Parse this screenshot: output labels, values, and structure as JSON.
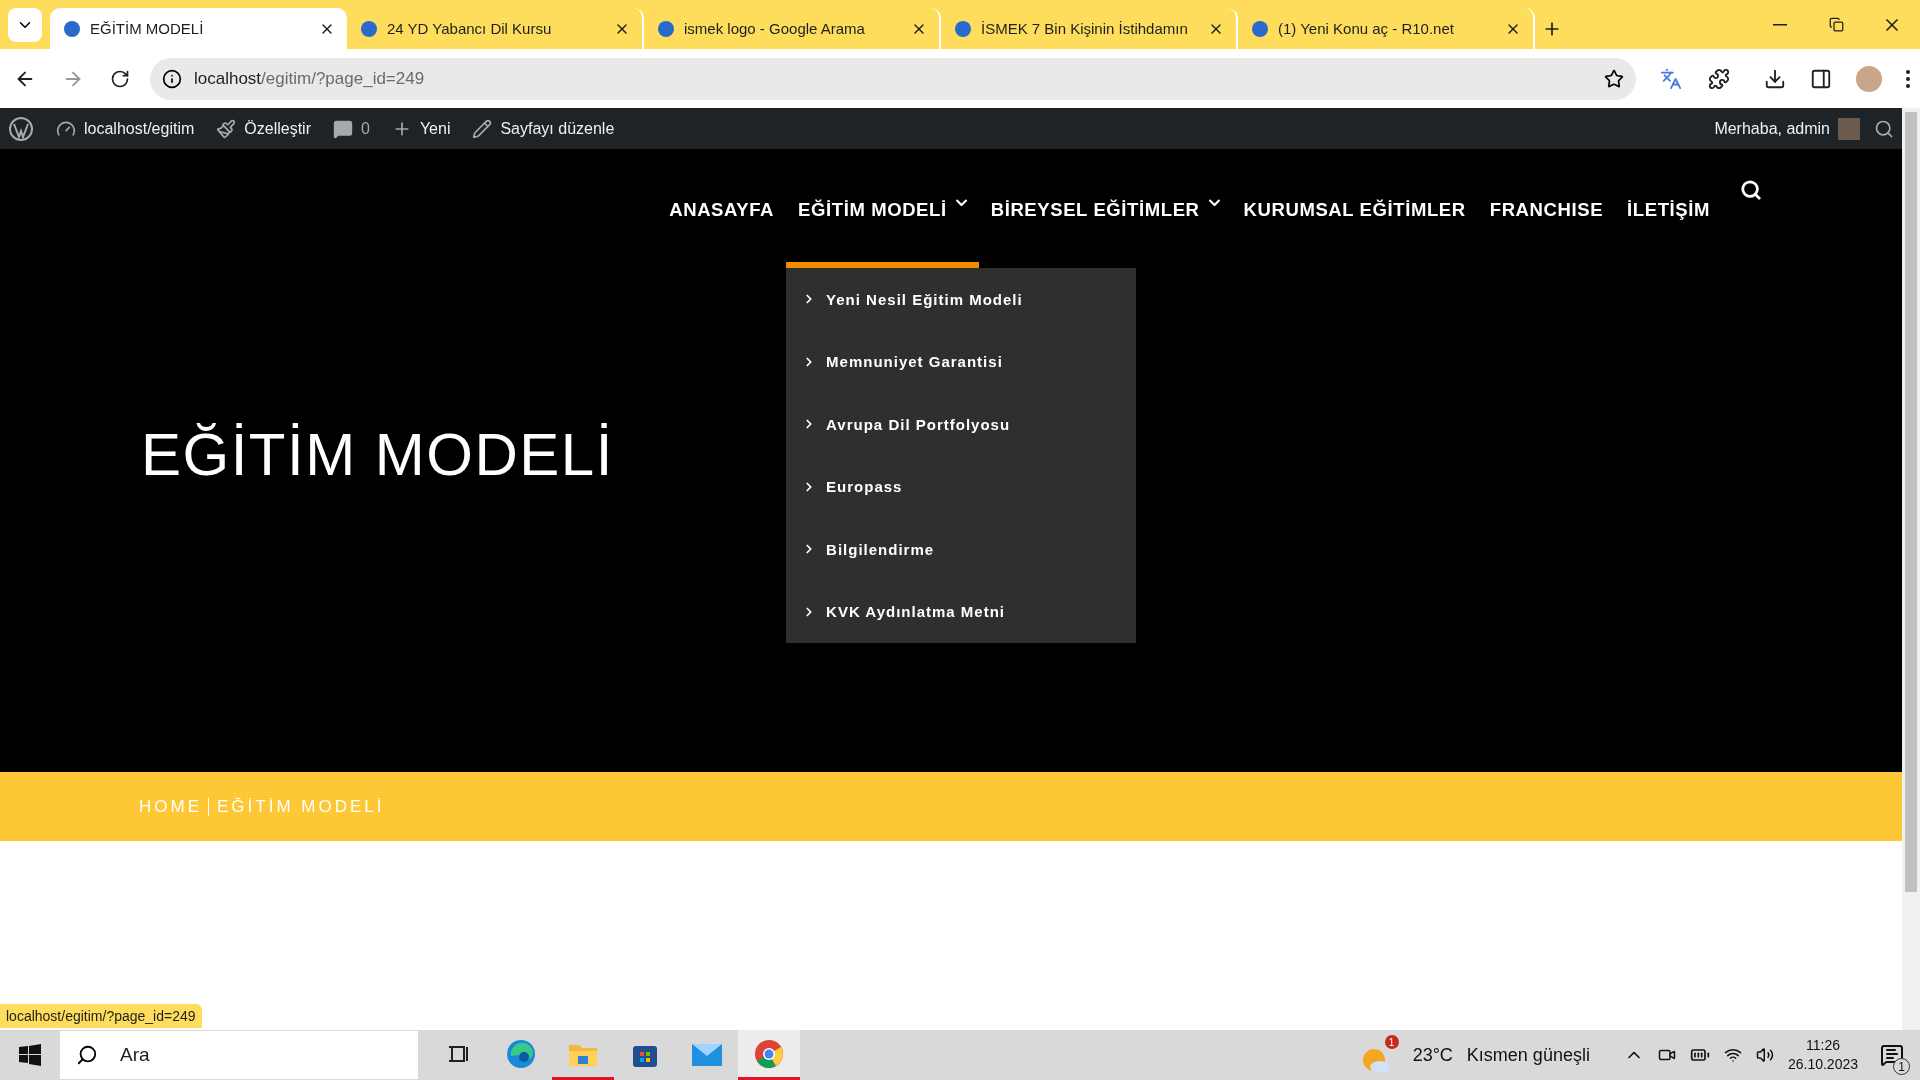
{
  "browser": {
    "tabs": [
      {
        "title": "EĞİTİM MODELİ",
        "selected": true
      },
      {
        "title": "24 YD Yabancı Dil Kursu",
        "selected": false
      },
      {
        "title": "ismek logo - Google Arama",
        "selected": false
      },
      {
        "title": "İSMEK 7 Bin Kişinin İstihdamın",
        "selected": false
      },
      {
        "title": "(1) Yeni Konu aç - R10.net",
        "selected": false
      }
    ],
    "url": {
      "host": "localhost",
      "path": "/egitim/?page_id=249"
    }
  },
  "admin_bar": {
    "site": "localhost/egitim",
    "customize": "Özelleştir",
    "comments": "0",
    "new": "Yeni",
    "edit": "Sayfayı düzenle",
    "greeting": "Merhaba, admin"
  },
  "nav": {
    "items": [
      {
        "label": "ANASAYFA",
        "has_dropdown": false,
        "selected": false
      },
      {
        "label": "EĞİTİM MODELİ",
        "has_dropdown": true,
        "selected": true
      },
      {
        "label": "BİREYSEL EĞİTİMLER",
        "has_dropdown": true,
        "selected": false
      },
      {
        "label": "KURUMSAL EĞİTİMLER",
        "has_dropdown": false,
        "selected": false
      },
      {
        "label": "FRANCHISE",
        "has_dropdown": false,
        "selected": false
      },
      {
        "label": "İLETİŞİM",
        "has_dropdown": false,
        "selected": false
      }
    ],
    "dropdown": [
      "Yeni Nesil Eğitim Modeli",
      "Memnuniyet Garantisi",
      "Avrupa Dil Portfolyosu",
      "Europass",
      "Bilgilendirme",
      "KVK Aydınlatma Metni"
    ]
  },
  "hero": {
    "title": "EĞİTİM MODELİ"
  },
  "breadcrumb": [
    "HOME",
    "EĞİTİM MODELİ"
  ],
  "status_url": "localhost/egitim/?page_id=249",
  "taskbar": {
    "search": {
      "placeholder": "Ara"
    },
    "apps": [
      {
        "kind": "taskview",
        "running": false,
        "selected": false
      },
      {
        "kind": "edge",
        "running": false,
        "selected": false
      },
      {
        "kind": "explorer",
        "running": true,
        "selected": false
      },
      {
        "kind": "store",
        "running": false,
        "selected": false
      },
      {
        "kind": "mail",
        "running": false,
        "selected": false
      },
      {
        "kind": "chrome",
        "running": true,
        "selected": true
      }
    ],
    "weather": {
      "badge": "1",
      "temperature": "23°C",
      "condition": "Kısmen güneşli"
    },
    "time": "11:26",
    "date": "26.10.2023",
    "notifications": "1"
  }
}
